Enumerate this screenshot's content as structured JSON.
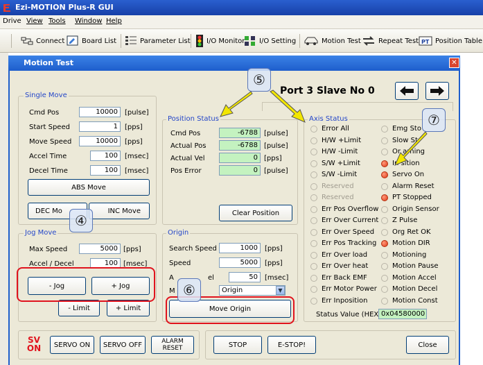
{
  "app": {
    "title": "Ezi-MOTION Plus-R GUI",
    "menu": [
      "Drive",
      "View",
      "Tools",
      "Window",
      "Help"
    ],
    "toolbar": [
      "Connect",
      "Board List",
      "Parameter List",
      "I/O Monitor",
      "I/O Setting",
      "Motion Test",
      "Repeat Test",
      "Position Table"
    ]
  },
  "dialog": {
    "title": "Motion Test",
    "port_label": "Port 3 Slave No 0"
  },
  "single_move": {
    "title": "Single Move",
    "rows": [
      {
        "label": "Cmd Pos",
        "value": "10000",
        "unit": "[pulse]"
      },
      {
        "label": "Start Speed",
        "value": "1",
        "unit": "[pps]"
      },
      {
        "label": "Move Speed",
        "value": "10000",
        "unit": "[pps]"
      },
      {
        "label": "Accel Time",
        "value": "100",
        "unit": "[msec]"
      },
      {
        "label": "Decel Time",
        "value": "100",
        "unit": "[msec]"
      }
    ],
    "abs_move": "ABS Move",
    "dec_move": "DEC Mo",
    "inc_move": "INC Move"
  },
  "position_status": {
    "title": "Position Status",
    "rows": [
      {
        "label": "Cmd Pos",
        "value": "-6788",
        "unit": "[pulse]"
      },
      {
        "label": "Actual Pos",
        "value": "-6788",
        "unit": "[pulse]"
      },
      {
        "label": "Actual Vel",
        "value": "0",
        "unit": "[pps]"
      },
      {
        "label": "Pos Error",
        "value": "0",
        "unit": "[pulse]"
      }
    ],
    "clear_position": "Clear Position"
  },
  "jog_move": {
    "title": "Jog Move",
    "rows": [
      {
        "label": "Max Speed",
        "value": "5000",
        "unit": "[pps]"
      },
      {
        "label": "Accel / Decel",
        "value": "100",
        "unit": "[msec]"
      }
    ],
    "jog_minus": "- Jog",
    "jog_plus": "+ Jog",
    "limit_minus": "- Limit",
    "limit_plus": "+ Limit"
  },
  "origin": {
    "title": "Origin",
    "search_speed_label": "Search Speed",
    "search_speed_value": "1000",
    "search_speed_unit": "[pps]",
    "speed_label": "Speed",
    "speed_value": "5000",
    "speed_unit": "[pps]",
    "accel_label_partial": "A",
    "accel_label_tail": "el",
    "accel_value": "50",
    "accel_unit": "[msec]",
    "mode_label_partial": "M",
    "mode_value": "Origin",
    "move_origin": "Move Origin"
  },
  "axis_status": {
    "title": "Axis Status",
    "left": [
      {
        "label": "Error All",
        "state": "off"
      },
      {
        "label": "H/W +Limit",
        "state": "off"
      },
      {
        "label": "H/W -Limit",
        "state": "off"
      },
      {
        "label": "S/W +Limit",
        "state": "off"
      },
      {
        "label": "S/W -Limit",
        "state": "off"
      },
      {
        "label": "Reserved",
        "state": "disabled"
      },
      {
        "label": "Reserved",
        "state": "disabled"
      },
      {
        "label": "Err Pos Overflow",
        "state": "off"
      },
      {
        "label": "Err Over Current",
        "state": "off"
      },
      {
        "label": "Err Over Speed",
        "state": "off"
      },
      {
        "label": "Err Pos Tracking",
        "state": "off"
      },
      {
        "label": "Err Over load",
        "state": "off"
      },
      {
        "label": "Err Over heat",
        "state": "off"
      },
      {
        "label": "Err Back EMF",
        "state": "off"
      },
      {
        "label": "Err Motor Power",
        "state": "off"
      },
      {
        "label": "Err Inposition",
        "state": "off"
      }
    ],
    "right": [
      {
        "label": "Emg Sto",
        "state": "off"
      },
      {
        "label": "Slow St",
        "state": "off"
      },
      {
        "label": "Or    arning",
        "state": "off"
      },
      {
        "label": "In    sition",
        "state": "on"
      },
      {
        "label": "Servo On",
        "state": "on"
      },
      {
        "label": "Alarm Reset",
        "state": "off"
      },
      {
        "label": "PT Stopped",
        "state": "on"
      },
      {
        "label": "Origin Sensor",
        "state": "off"
      },
      {
        "label": "Z Pulse",
        "state": "off"
      },
      {
        "label": "Org Ret OK",
        "state": "off"
      },
      {
        "label": "Motion DIR",
        "state": "on"
      },
      {
        "label": "Motioning",
        "state": "off"
      },
      {
        "label": "Motion Pause",
        "state": "off"
      },
      {
        "label": "Motion Accel",
        "state": "off"
      },
      {
        "label": "Motion Decel",
        "state": "off"
      },
      {
        "label": "Motion Const",
        "state": "off"
      }
    ],
    "status_value_label": "Status Value (HEX)",
    "status_value": "0x04580000"
  },
  "bottom": {
    "sv_top": "SV",
    "sv_bottom": "ON",
    "servo_on": "SERVO ON",
    "servo_off": "SERVO OFF",
    "alarm_reset_1": "ALARM",
    "alarm_reset_2": "RESET",
    "stop": "STOP",
    "estop": "E-STOP!",
    "close": "Close"
  },
  "callouts": [
    "⑤",
    "④",
    "⑥",
    "⑦"
  ],
  "colors": {
    "title_bar": "#1e5ecc",
    "led_on": "#e03a1a",
    "field_green": "#c4f2c0",
    "callout_red": "#e0131d",
    "arrow_yellow": "#f2e600"
  }
}
